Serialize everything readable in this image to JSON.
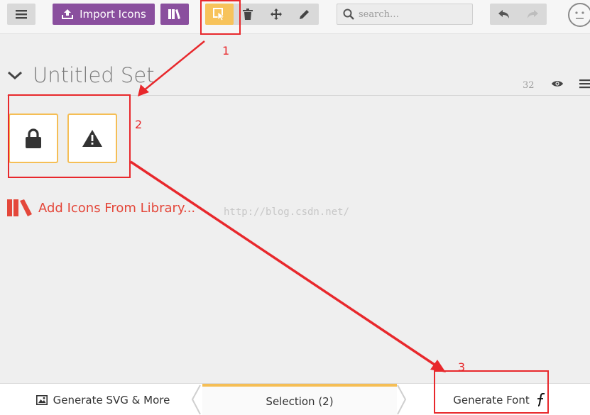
{
  "toolbar": {
    "import_label": "Import Icons",
    "search_placeholder": "search…"
  },
  "set": {
    "title": "Untitled Set",
    "size": "32"
  },
  "glyphs": [
    {
      "icon": "lock-icon"
    },
    {
      "icon": "warning-icon"
    }
  ],
  "library": {
    "add_label": "Add Icons From Library..."
  },
  "watermark": "http://blog.csdn.net/",
  "bottom": {
    "svg_label": "Generate SVG & More",
    "selection_label": "Selection (2)",
    "font_label": "Generate Font"
  },
  "annotations": {
    "n1": "1",
    "n2": "2",
    "n3": "3"
  },
  "colors": {
    "accent": "#f5be55",
    "purple": "#8a4f9e",
    "library_red": "#e4473a",
    "annotation_red": "#e8282c"
  }
}
